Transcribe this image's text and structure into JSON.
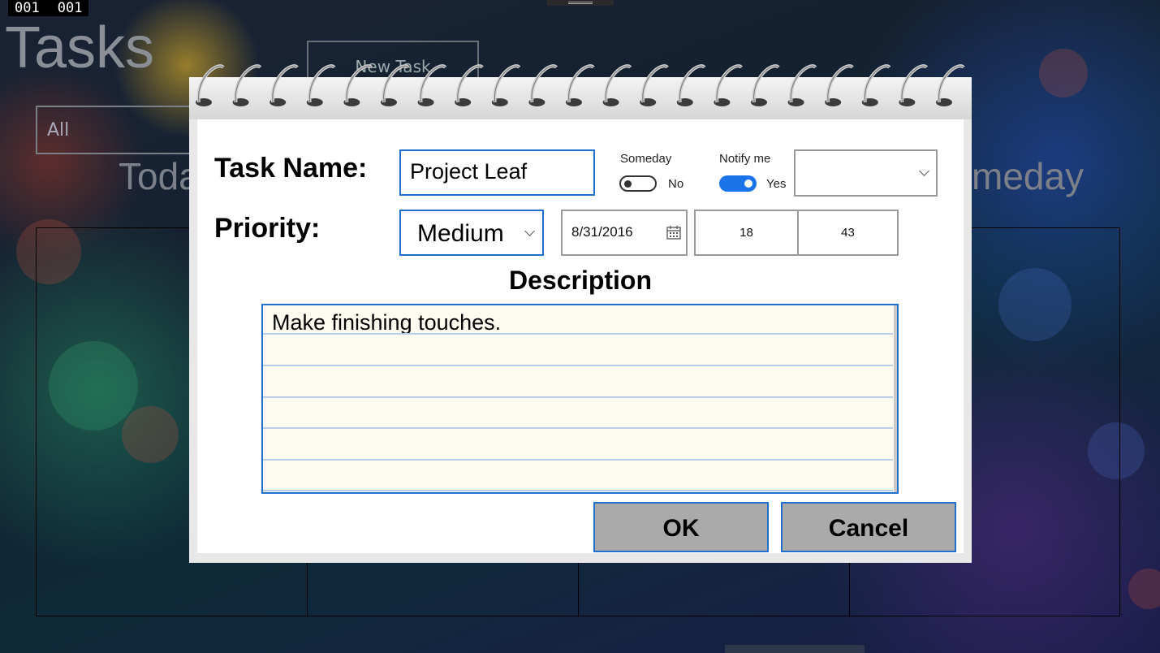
{
  "debug_counters": [
    "001",
    "001"
  ],
  "app": {
    "title": "Tasks",
    "new_task_label": "New Task",
    "filter_value": "All",
    "columns": [
      "Toda",
      "meday"
    ]
  },
  "dialog": {
    "task_name_label": "Task Name:",
    "task_name_value": "Project Leaf",
    "someday_label": "Someday",
    "someday_state": "No",
    "notify_label": "Notify me",
    "notify_state": "Yes",
    "notify_select_value": "",
    "priority_label": "Priority:",
    "priority_value": "Medium",
    "date_value": "8/31/2016",
    "hour_value": "18",
    "minute_value": "43",
    "description_label": "Description",
    "description_value": "Make finishing touches.",
    "ok_label": "OK",
    "cancel_label": "Cancel"
  },
  "colors": {
    "accent": "#1f6fce",
    "toggle_on": "#1a73e8",
    "button_gray": "#aaaaaa",
    "notepad_paper": "#fdfaf0"
  },
  "icons": [
    "calendar-icon",
    "chevron-down-icon",
    "spiral-binding"
  ]
}
